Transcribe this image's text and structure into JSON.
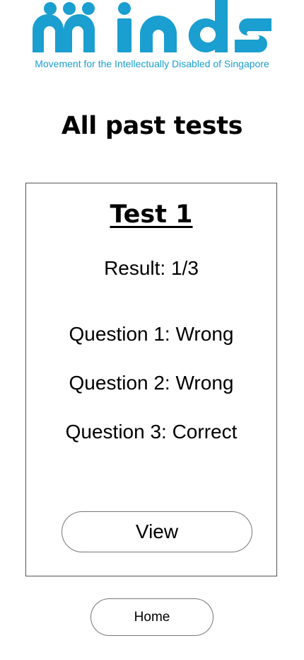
{
  "brand": {
    "logo_text": "minds",
    "tagline": "Movement for the Intellectually Disabled of Singapore",
    "color": "#1a9fd0"
  },
  "page": {
    "title": "All past tests"
  },
  "tests": [
    {
      "title": "Test 1",
      "result": "Result: 1/3",
      "questions": [
        "Question 1: Wrong",
        "Question 2: Wrong",
        "Question 3: Correct"
      ],
      "view_label": "View"
    }
  ],
  "nav": {
    "home_label": "Home"
  }
}
